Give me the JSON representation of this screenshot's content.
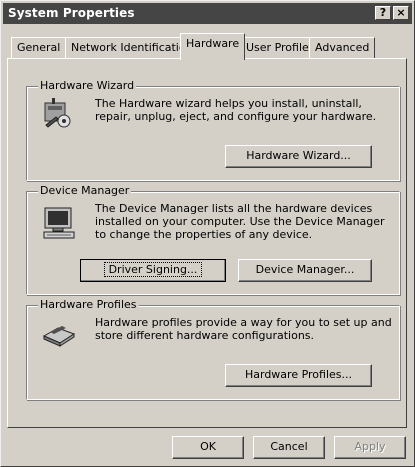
{
  "window": {
    "title": "System Properties",
    "help_glyph": "?",
    "close_glyph": "×"
  },
  "tabs": [
    {
      "label": "General"
    },
    {
      "label": "Network Identification"
    },
    {
      "label": "Hardware"
    },
    {
      "label": "User Profiles"
    },
    {
      "label": "Advanced"
    }
  ],
  "hardware_wizard": {
    "legend": "Hardware Wizard",
    "description": "The Hardware wizard helps you install, uninstall, repair, unplug, eject, and configure your hardware.",
    "button": "Hardware Wizard..."
  },
  "device_manager": {
    "legend": "Device Manager",
    "description": "The Device Manager lists all the hardware devices installed on your computer. Use the Device Manager to change the properties of any device.",
    "driver_signing_button": "Driver Signing...",
    "device_manager_button": "Device Manager..."
  },
  "hardware_profiles": {
    "legend": "Hardware Profiles",
    "description": "Hardware profiles provide a way for you to set up and store different hardware configurations.",
    "button": "Hardware Profiles..."
  },
  "footer": {
    "ok": "OK",
    "cancel": "Cancel",
    "apply": "Apply"
  }
}
